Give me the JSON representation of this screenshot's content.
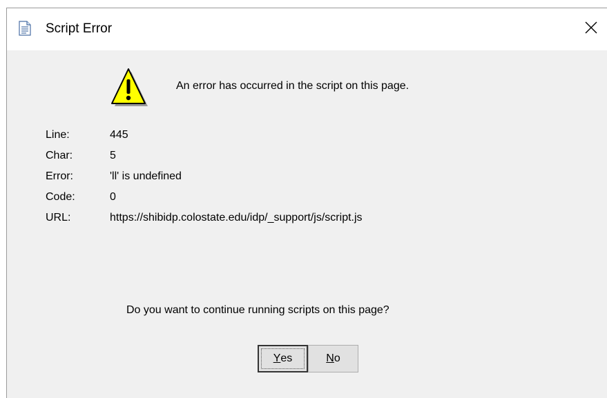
{
  "background_fragment": "",
  "dialog": {
    "title": "Script Error",
    "message": "An error has occurred in the script on this page.",
    "details": [
      {
        "label": "Line:",
        "value": "445"
      },
      {
        "label": "Char:",
        "value": "5"
      },
      {
        "label": "Error:",
        "value": "'ll' is undefined"
      },
      {
        "label": "Code:",
        "value": "0"
      },
      {
        "label": "URL:",
        "value": "https://shibidp.colostate.edu/idp/_support/js/script.js"
      }
    ],
    "question": "Do you want to continue running scripts on this page?",
    "buttons": {
      "yes": {
        "accel": "Y",
        "rest": "es"
      },
      "no": {
        "accel": "N",
        "rest": "o"
      }
    }
  },
  "icons": {
    "title": "document-icon",
    "warning": "warning-icon",
    "close": "close-icon"
  },
  "colors": {
    "dialog_bg": "#f0f0f0",
    "titlebar_bg": "#ffffff",
    "warning_yellow": "#ffff00",
    "button_bg": "#e1e1e1"
  }
}
